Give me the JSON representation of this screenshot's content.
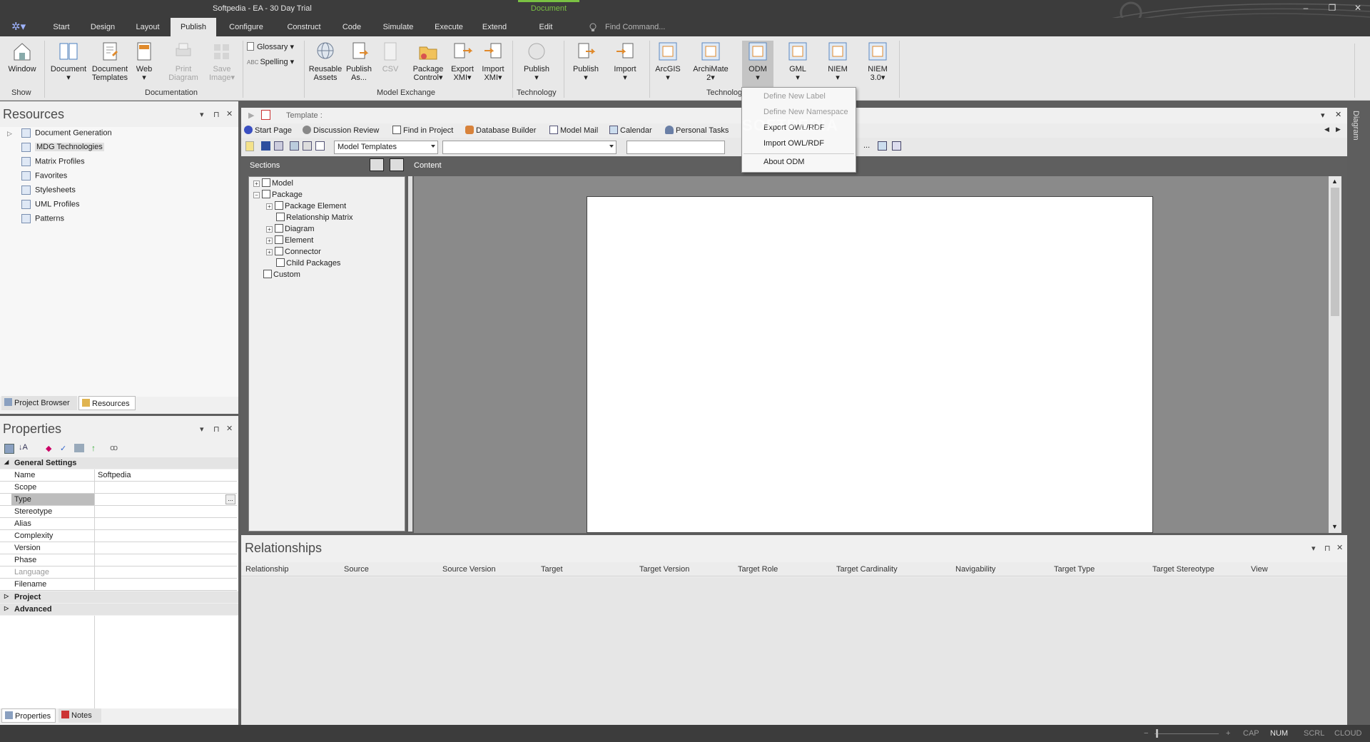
{
  "window": {
    "title": "Softpedia - EA - 30 Day Trial",
    "context_tab": "Document"
  },
  "menu": {
    "tabs": [
      "Start",
      "Design",
      "Layout",
      "Publish",
      "Configure",
      "Construct",
      "Code",
      "Simulate",
      "Execute",
      "Extend",
      "Edit"
    ],
    "active": "Publish",
    "find_placeholder": "Find Command..."
  },
  "ribbon": {
    "window": "Window",
    "document": "Document",
    "doc_templates_1": "Document",
    "doc_templates_2": "Templates",
    "web": "Web",
    "print_1": "Print",
    "print_2": "Diagram",
    "save_1": "Save",
    "save_2": "Image",
    "glossary": "Glossary",
    "spelling": "Spelling",
    "reusable_1": "Reusable",
    "reusable_2": "Assets",
    "publish_as_1": "Publish",
    "publish_as_2": "As...",
    "csv": "CSV",
    "pkg_control_1": "Package",
    "pkg_control_2": "Control",
    "export_xmi_1": "Export",
    "export_xmi_2": "XMI",
    "import_xmi_1": "Import",
    "import_xmi_2": "XMI",
    "publish_tech": "Publish",
    "publish": "Publish",
    "import": "Import",
    "arcgis": "ArcGIS",
    "archimate_1": "ArchiMate",
    "archimate_2": "2",
    "odm": "ODM",
    "gml": "GML",
    "niem": "NIEM",
    "niem3_1": "NIEM",
    "niem3_2": "3.0",
    "groups": {
      "show": "Show",
      "documentation": "Documentation",
      "model_exchange": "Model Exchange",
      "technology": "Technology",
      "technology2": "Technolog"
    }
  },
  "resources": {
    "title": "Resources",
    "items": [
      "Document Generation",
      "MDG Technologies",
      "Matrix Profiles",
      "Favorites",
      "Stylesheets",
      "UML Profiles",
      "Patterns"
    ],
    "tabs": [
      "Project Browser",
      "Resources"
    ]
  },
  "properties": {
    "title": "Properties",
    "section": "General Settings",
    "rows": [
      {
        "k": "Name",
        "v": "Softpedia"
      },
      {
        "k": "Scope",
        "v": ""
      },
      {
        "k": "Type",
        "v": ""
      },
      {
        "k": "Stereotype",
        "v": ""
      },
      {
        "k": "Alias",
        "v": ""
      },
      {
        "k": "Complexity",
        "v": ""
      },
      {
        "k": "Version",
        "v": ""
      },
      {
        "k": "Phase",
        "v": ""
      },
      {
        "k": "Language",
        "v": ""
      },
      {
        "k": "Filename",
        "v": ""
      }
    ],
    "groups": [
      "Project",
      "Advanced"
    ],
    "ellipsis": "...",
    "tabs": [
      "Properties",
      "Notes"
    ]
  },
  "document": {
    "template_label": "Template :",
    "tabs": [
      "Start Page",
      "Discussion Review",
      "Find in Project",
      "Database Builder",
      "Model Mail",
      "Calendar",
      "Personal Tasks"
    ],
    "combo1": "Model Templates",
    "ellipsis": "...",
    "sections_label": "Sections",
    "content_label": "Content",
    "sections": [
      "Model",
      "Package",
      "Package Element",
      "Relationship Matrix",
      "Diagram",
      "Element",
      "Connector",
      "Child Packages",
      "Custom"
    ],
    "side_label": "Diagram"
  },
  "odm_menu": {
    "items": [
      "Define New Label",
      "Define New Namespace",
      "Export OWL/RDF",
      "Import OWL/RDF",
      "About ODM"
    ]
  },
  "watermark": "SOFTPEDIA",
  "relationships": {
    "title": "Relationships",
    "columns": [
      "Relationship",
      "Source",
      "Source Version",
      "Target",
      "Target Version",
      "Target Role",
      "Target Cardinality",
      "Navigability",
      "Target Type",
      "Target Stereotype",
      "View"
    ]
  },
  "status": {
    "cap": "CAP",
    "num": "NUM",
    "scrl": "SCRL",
    "cloud": "CLOUD",
    "minus": "−",
    "plus": "+"
  },
  "colors": {
    "accent_green": "#7ac143",
    "dark_chrome": "#3c3c3c",
    "ribbon": "#e8e8e8"
  }
}
